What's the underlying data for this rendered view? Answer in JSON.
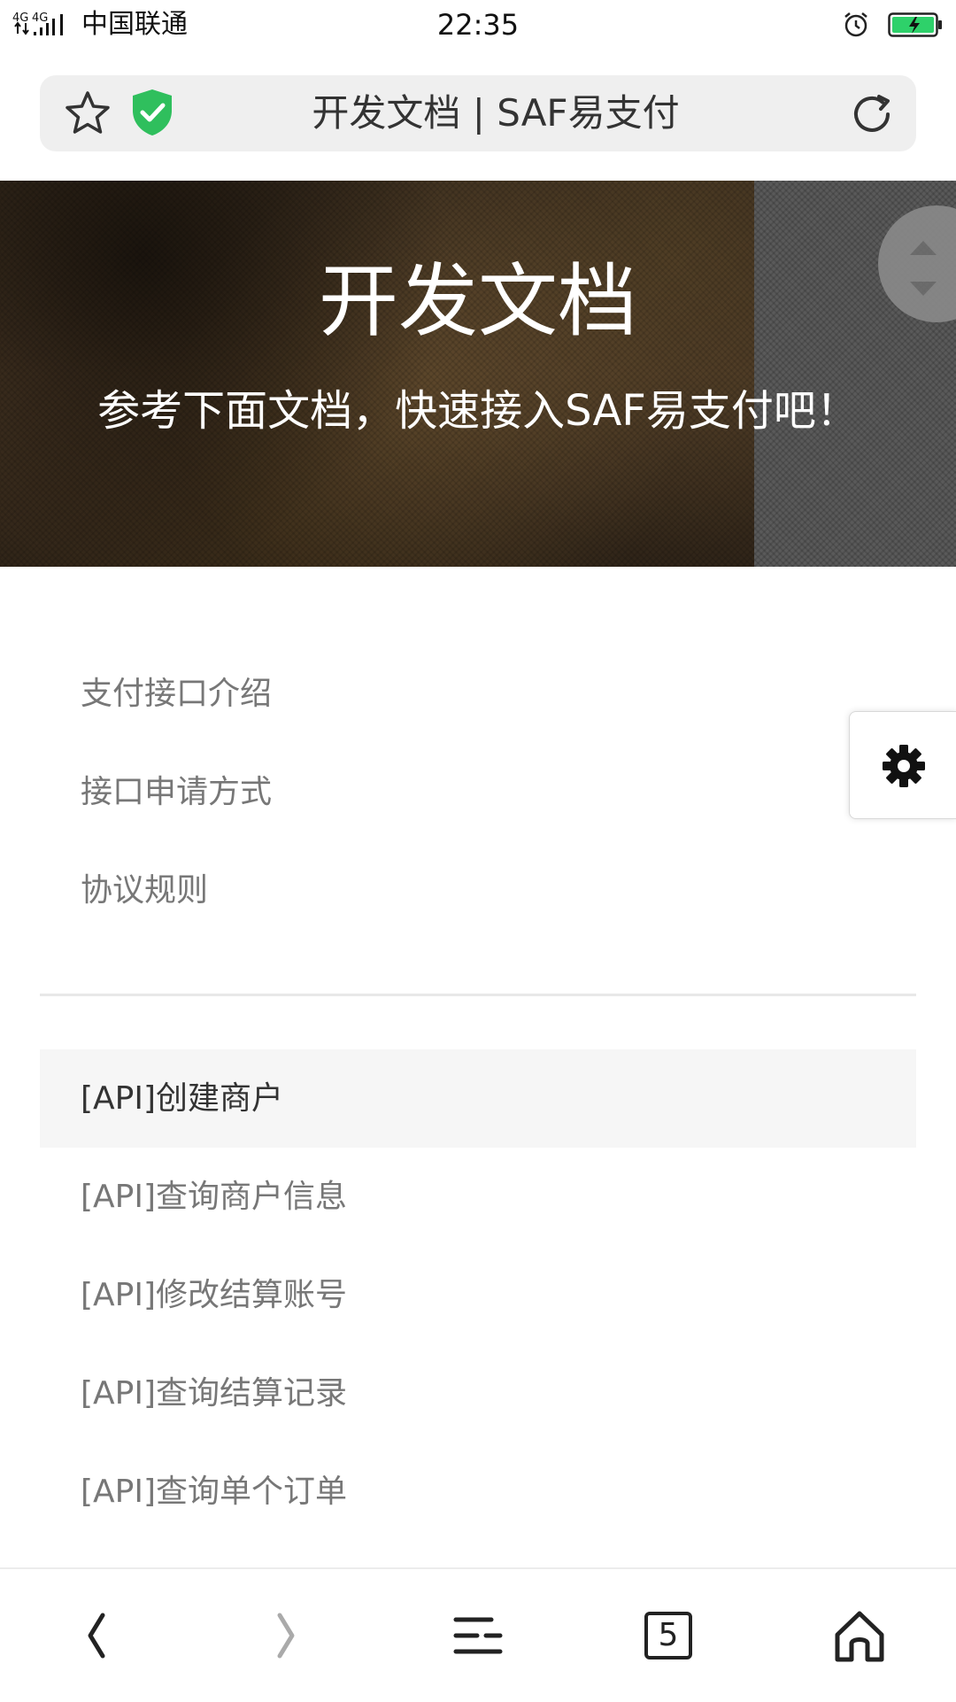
{
  "status_bar": {
    "network": "4G 4G",
    "carrier": "中国联通",
    "time": "22:35"
  },
  "address_bar": {
    "title": "开发文档 | SAF易支付"
  },
  "hero": {
    "title": "开发文档",
    "subtitle": "参考下面文档，快速接入SAF易支付吧！"
  },
  "nav": {
    "items": [
      {
        "label": "支付接口介绍"
      },
      {
        "label": "接口申请方式"
      },
      {
        "label": "协议规则"
      }
    ]
  },
  "api_nav": {
    "items": [
      {
        "label": "[API]创建商户",
        "active": true
      },
      {
        "label": "[API]查询商户信息"
      },
      {
        "label": "[API]修改结算账号"
      },
      {
        "label": "[API]查询结算记录"
      },
      {
        "label": "[API]查询单个订单"
      }
    ]
  },
  "toolbar": {
    "tabs_count": "5",
    "icons": [
      "back-icon",
      "forward-icon",
      "menu-icon",
      "tabs-icon",
      "home-icon"
    ]
  },
  "colors": {
    "shield": "#2fbf5d",
    "battery": "#2ed16a",
    "active_item_bg": "#f6f6f6"
  }
}
